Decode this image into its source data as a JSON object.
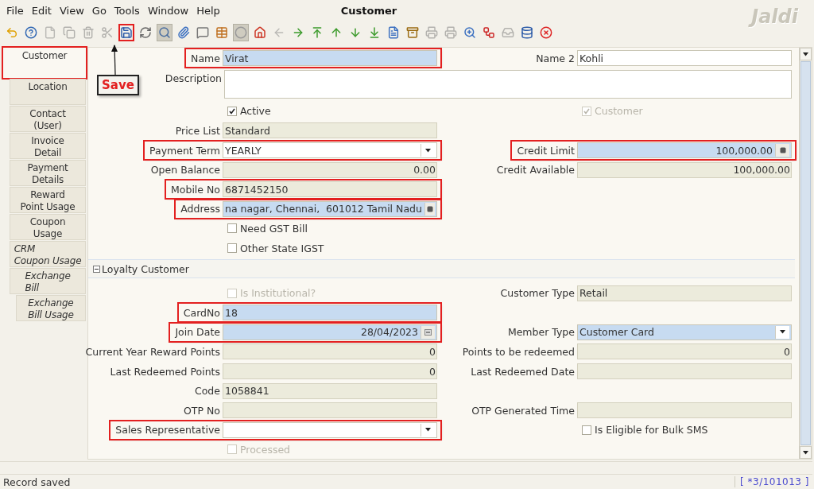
{
  "menu": [
    "File",
    "Edit",
    "View",
    "Go",
    "Tools",
    "Window",
    "Help"
  ],
  "window": {
    "title": "Customer"
  },
  "logo": "Jaldi",
  "toolbar": [
    {
      "kind": "undo",
      "pressed": false,
      "disabled": false,
      "annotated": false
    },
    {
      "kind": "help",
      "pressed": false,
      "disabled": false,
      "annotated": false
    },
    {
      "kind": "new",
      "pressed": false,
      "disabled": true,
      "annotated": false
    },
    {
      "kind": "copy",
      "pressed": false,
      "disabled": true,
      "annotated": false
    },
    {
      "kind": "delete",
      "pressed": false,
      "disabled": true,
      "annotated": false
    },
    {
      "kind": "delete-selection",
      "pressed": false,
      "disabled": true,
      "annotated": false
    },
    {
      "kind": "save",
      "pressed": false,
      "disabled": false,
      "annotated": true
    },
    {
      "kind": "refresh",
      "pressed": false,
      "disabled": false,
      "annotated": false
    },
    {
      "kind": "find",
      "pressed": true,
      "disabled": false,
      "annotated": false
    },
    {
      "kind": "attachment",
      "pressed": false,
      "disabled": false,
      "annotated": false
    },
    {
      "kind": "chat",
      "pressed": false,
      "disabled": false,
      "annotated": false
    },
    {
      "kind": "grid",
      "pressed": false,
      "disabled": false,
      "annotated": false
    },
    {
      "kind": "history",
      "pressed": true,
      "disabled": false,
      "annotated": false
    },
    {
      "kind": "home",
      "pressed": false,
      "disabled": false,
      "annotated": false
    },
    {
      "kind": "back",
      "pressed": false,
      "disabled": true,
      "annotated": false
    },
    {
      "kind": "forward",
      "pressed": false,
      "disabled": false,
      "annotated": false
    },
    {
      "kind": "first",
      "pressed": false,
      "disabled": false,
      "annotated": false
    },
    {
      "kind": "previous",
      "pressed": false,
      "disabled": false,
      "annotated": false
    },
    {
      "kind": "next",
      "pressed": false,
      "disabled": false,
      "annotated": false
    },
    {
      "kind": "last",
      "pressed": false,
      "disabled": false,
      "annotated": false
    },
    {
      "kind": "report",
      "pressed": false,
      "disabled": false,
      "annotated": false
    },
    {
      "kind": "archive",
      "pressed": false,
      "disabled": false,
      "annotated": false
    },
    {
      "kind": "print-preview",
      "pressed": false,
      "disabled": true,
      "annotated": false
    },
    {
      "kind": "print",
      "pressed": false,
      "disabled": true,
      "annotated": false
    },
    {
      "kind": "zoom",
      "pressed": false,
      "disabled": false,
      "annotated": false
    },
    {
      "kind": "workflow",
      "pressed": false,
      "disabled": false,
      "annotated": false
    },
    {
      "kind": "request",
      "pressed": false,
      "disabled": true,
      "annotated": false
    },
    {
      "kind": "product",
      "pressed": false,
      "disabled": false,
      "annotated": false
    },
    {
      "kind": "close",
      "pressed": false,
      "disabled": false,
      "annotated": false
    }
  ],
  "callout": {
    "text": "Save"
  },
  "tabs": [
    {
      "label": "Customer",
      "selected": true,
      "italic": false,
      "annotated": true
    },
    {
      "label": "Location",
      "selected": false,
      "italic": false,
      "annotated": false
    },
    {
      "label": "Contact\n(User)",
      "selected": false,
      "italic": false,
      "annotated": false
    },
    {
      "label": "Invoice\nDetail",
      "selected": false,
      "italic": false,
      "annotated": false
    },
    {
      "label": "Payment\nDetails",
      "selected": false,
      "italic": false,
      "annotated": false
    },
    {
      "label": "Reward\nPoint Usage",
      "selected": false,
      "italic": false,
      "annotated": false
    },
    {
      "label": "Coupon\nUsage",
      "selected": false,
      "italic": false,
      "annotated": false
    },
    {
      "label": "CRM\nCoupon Usage",
      "selected": false,
      "italic": true,
      "annotated": false
    },
    {
      "label": "Exchange\nBill",
      "selected": false,
      "italic": true,
      "annotated": false,
      "children": [
        {
          "label": "Exchange\nBill Usage",
          "selected": false,
          "italic": true,
          "annotated": false
        }
      ]
    }
  ],
  "form": {
    "rows": [
      {
        "kind": "fields",
        "left": {
          "kind": "text",
          "label": "Name",
          "value": "Virat",
          "mandatory": true,
          "readonly": false,
          "annotated": true
        },
        "right": {
          "kind": "text",
          "label": "Name 2",
          "value": "Kohli",
          "mandatory": false,
          "readonly": false,
          "annotated": false
        }
      },
      {
        "kind": "wide",
        "field": {
          "kind": "textarea",
          "label": "Description",
          "mandatory": false,
          "readonly": false,
          "annotated": false
        }
      },
      {
        "kind": "fields",
        "left": {
          "kind": "checkbox",
          "label": "Active",
          "checked": true,
          "disabled": false
        },
        "right": {
          "kind": "checkbox",
          "label": "Customer",
          "checked": true,
          "disabled": true
        }
      },
      {
        "kind": "fields",
        "left": {
          "kind": "text",
          "label": "Price List",
          "value": "Standard",
          "mandatory": false,
          "readonly": true,
          "annotated": false
        }
      },
      {
        "kind": "fields",
        "left": {
          "kind": "select",
          "label": "Payment Term",
          "value": "YEARLY",
          "mandatory": false,
          "readonly": false,
          "annotated": true
        },
        "right": {
          "kind": "number-lookup",
          "label": "Credit Limit",
          "value": "100,000.00",
          "mandatory": true,
          "readonly": false,
          "annotated": true
        }
      },
      {
        "kind": "fields",
        "left": {
          "kind": "number",
          "label": "Open Balance",
          "value": "0.00",
          "mandatory": false,
          "readonly": true,
          "annotated": false
        },
        "right": {
          "kind": "number",
          "label": "Credit Available",
          "value": "100,000.00",
          "mandatory": false,
          "readonly": true,
          "annotated": false
        }
      },
      {
        "kind": "fields",
        "left": {
          "kind": "text",
          "label": "Mobile No",
          "value": "6871452150",
          "mandatory": false,
          "readonly": true,
          "annotated": true
        }
      },
      {
        "kind": "fields",
        "left": {
          "kind": "lookup",
          "label": "Address",
          "value": "na nagar, Chennai,  601012 Tamil Nadu",
          "mandatory": true,
          "readonly": false,
          "annotated": true
        }
      },
      {
        "kind": "fields",
        "left": {
          "kind": "checkbox",
          "label": "Need GST Bill",
          "checked": false,
          "disabled": false
        }
      },
      {
        "kind": "fields",
        "left": {
          "kind": "checkbox",
          "label": "Other State IGST",
          "checked": false,
          "disabled": false
        }
      },
      {
        "kind": "section",
        "label": "Loyalty Customer",
        "expanded": true
      },
      {
        "kind": "fields",
        "left": {
          "kind": "checkbox",
          "label": "Is Institutional?",
          "checked": false,
          "disabled": true
        },
        "right": {
          "kind": "text",
          "label": "Customer Type",
          "value": "Retail",
          "mandatory": false,
          "readonly": true,
          "annotated": false
        }
      },
      {
        "kind": "fields",
        "left": {
          "kind": "text",
          "label": "CardNo",
          "value": "18",
          "mandatory": true,
          "readonly": false,
          "annotated": true
        }
      },
      {
        "kind": "fields",
        "left": {
          "kind": "date",
          "label": "Join Date",
          "value": "28/04/2023",
          "mandatory": true,
          "readonly": false,
          "annotated": true
        },
        "right": {
          "kind": "select",
          "label": "Member Type",
          "value": "Customer Card",
          "mandatory": true,
          "readonly": false,
          "annotated": false
        }
      },
      {
        "kind": "fields",
        "left": {
          "kind": "number",
          "label": "Current Year Reward Points",
          "value": "0",
          "mandatory": false,
          "readonly": true,
          "annotated": false
        },
        "right": {
          "kind": "number",
          "label": "Points to be redeemed",
          "value": "0",
          "mandatory": false,
          "readonly": true,
          "annotated": false
        }
      },
      {
        "kind": "fields",
        "left": {
          "kind": "number",
          "label": "Last Redeemed Points",
          "value": "0",
          "mandatory": false,
          "readonly": true,
          "annotated": false
        },
        "right": {
          "kind": "text",
          "label": "Last Redeemed Date",
          "mandatory": false,
          "readonly": true,
          "annotated": false
        }
      },
      {
        "kind": "fields",
        "left": {
          "kind": "text",
          "label": "Code",
          "value": "1058841",
          "mandatory": false,
          "readonly": true,
          "annotated": false
        }
      },
      {
        "kind": "fields",
        "left": {
          "kind": "text",
          "label": "OTP No",
          "mandatory": false,
          "readonly": true,
          "annotated": false
        },
        "right": {
          "kind": "text",
          "label": "OTP Generated Time",
          "mandatory": false,
          "readonly": true,
          "annotated": false
        }
      },
      {
        "kind": "fields",
        "left": {
          "kind": "select",
          "label": "Sales Representative",
          "mandatory": false,
          "readonly": false,
          "annotated": true
        },
        "right": {
          "kind": "checkbox",
          "label": "Is Eligible for Bulk SMS",
          "checked": false,
          "disabled": false
        }
      },
      {
        "kind": "fields",
        "left": {
          "kind": "checkbox",
          "label": "Processed",
          "checked": false,
          "disabled": true
        }
      }
    ]
  },
  "status_bar": {
    "message": "Record saved",
    "record": "[ *3/101013 ]"
  }
}
